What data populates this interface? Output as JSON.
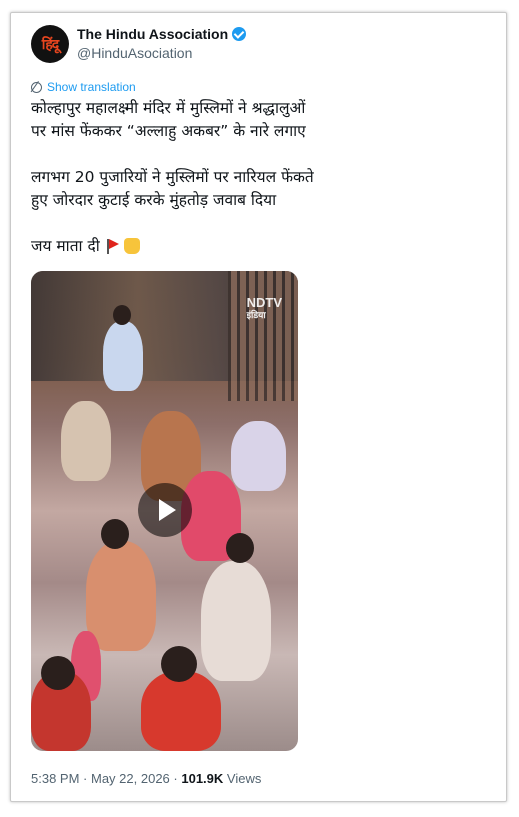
{
  "account": {
    "avatar_text": "हिंदू",
    "display_name": "The Hindu Association",
    "handle": "@HinduAsociation",
    "verified": true
  },
  "tweet": {
    "translate_label": "Show translation",
    "line1": "कोल्हापुर महालक्ष्मी मंदिर में मुस्लिमों ने श्रद्धालुओं",
    "line2": "पर मांस फेंककर “अल्लाहु अकबर” के नारे लगाए",
    "line3": "लगभग 20 पुजारियों ने मुस्लिमों पर नारियल फेंकते",
    "line4": "हुए जोरदार कुटाई करके मुंहतोड़ जवाब दिया",
    "line5": "जय माता दी"
  },
  "media": {
    "watermark": "NDTV",
    "watermark_sub": "इंडिया"
  },
  "meta": {
    "time": "5:38 PM",
    "date": "May 22, 2026",
    "views_count": "101.9K",
    "views_label": "Views"
  },
  "colors": {
    "accent": "#1d9bf0",
    "text": "#0f1419",
    "muted": "#536471"
  }
}
